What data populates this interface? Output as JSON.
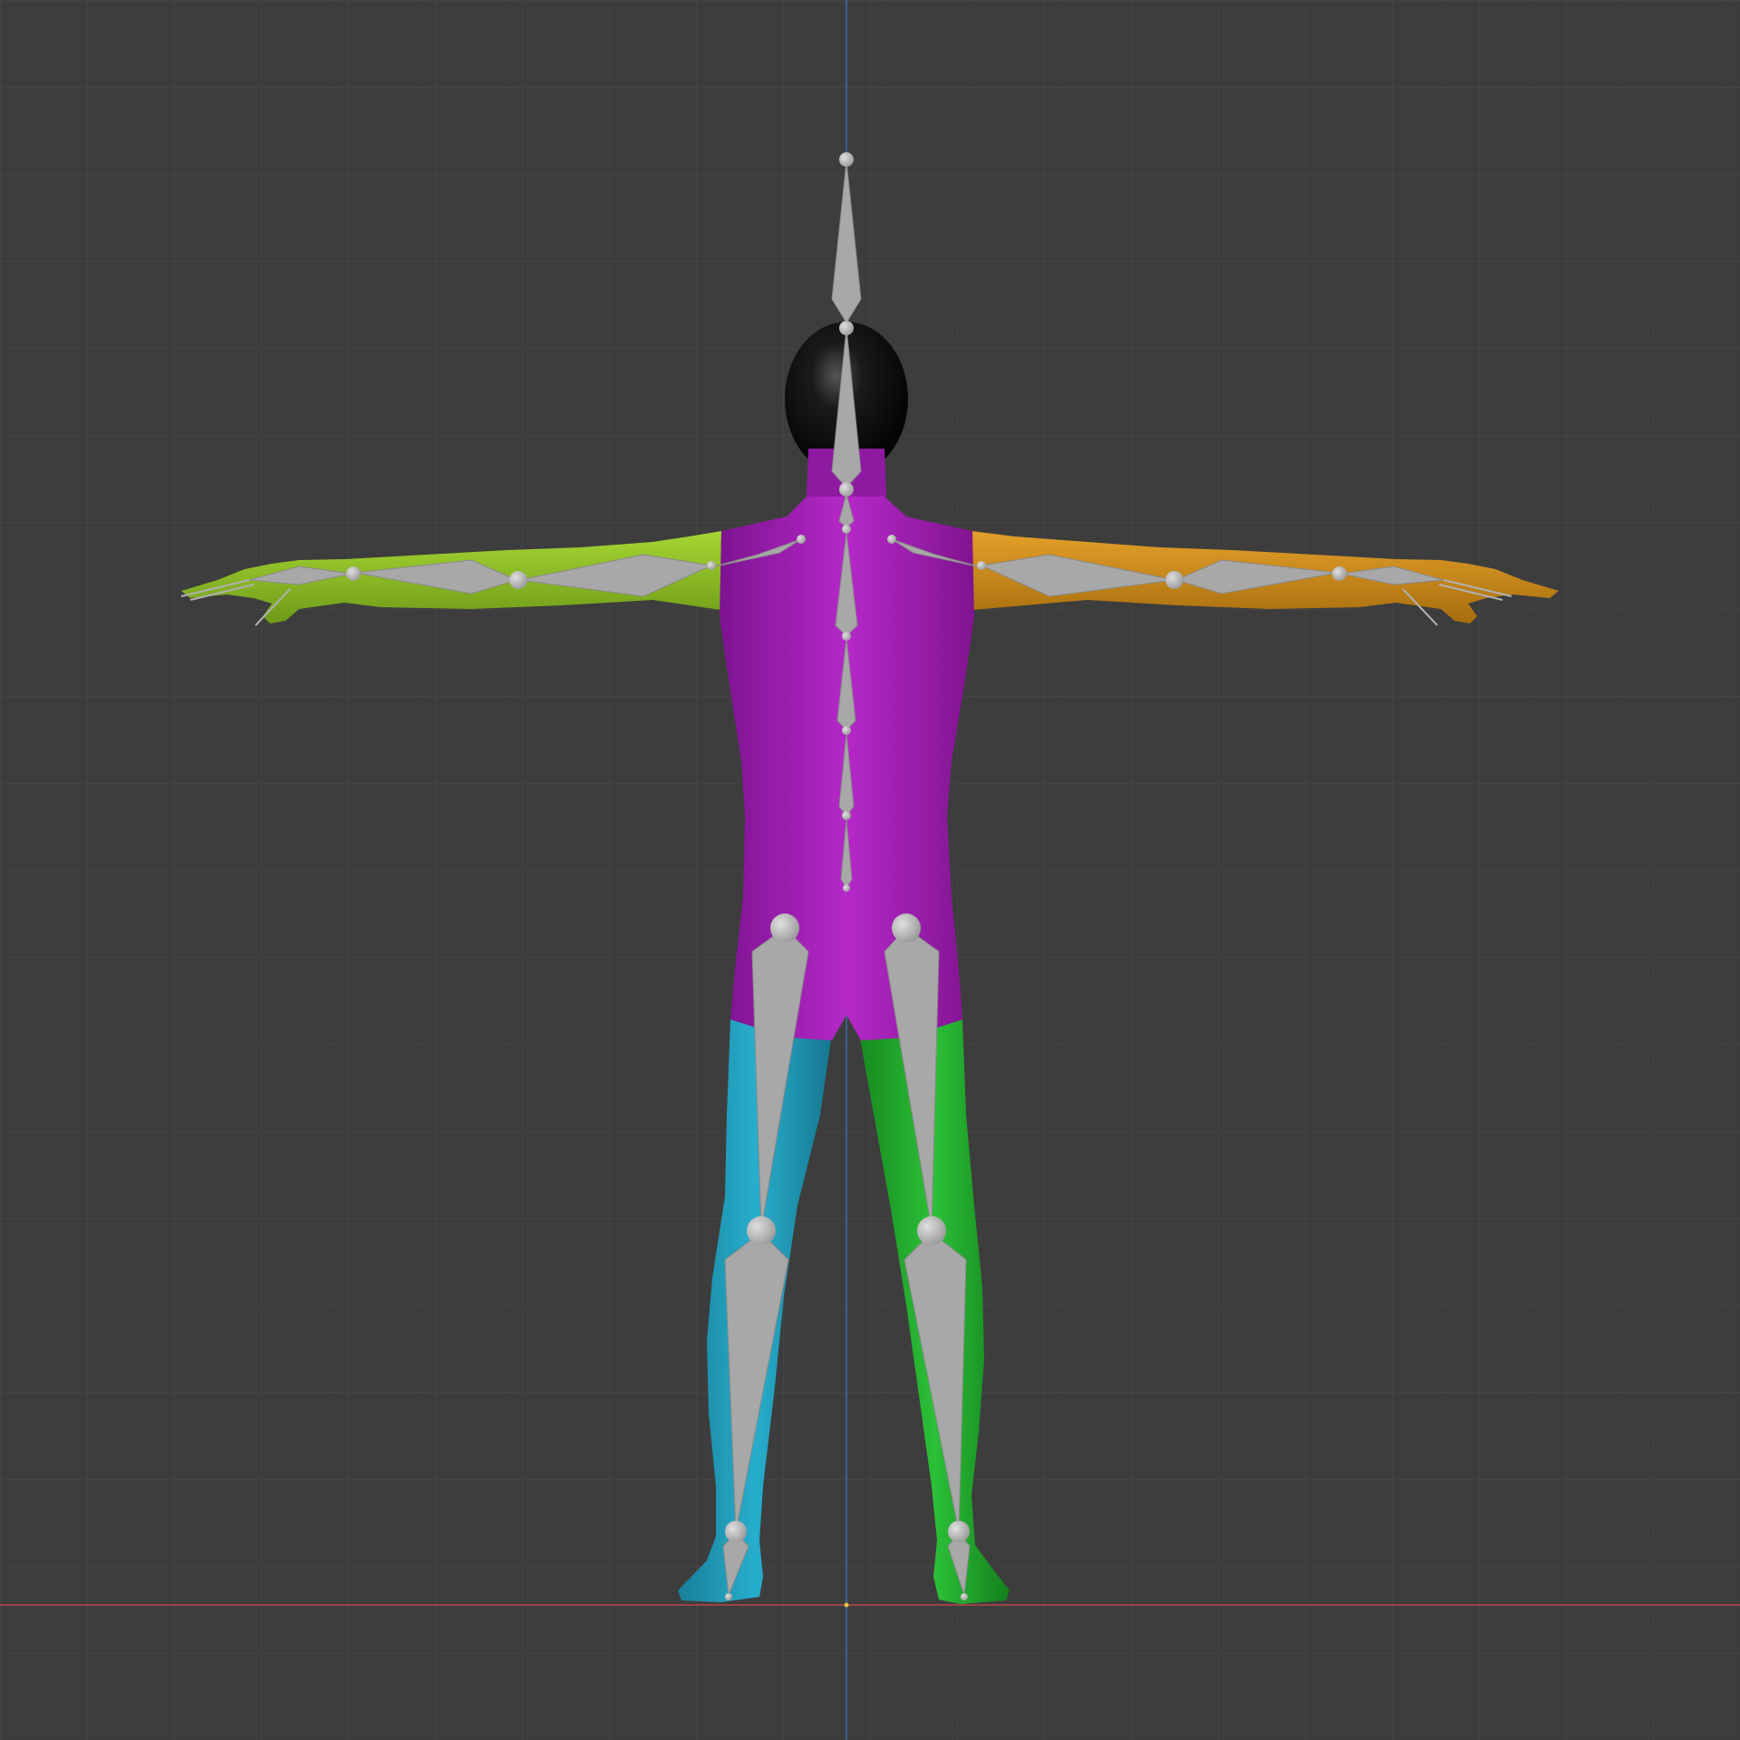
{
  "viewport": {
    "view": "front-orthographic",
    "grid": true,
    "background_color": "#3d3d3d",
    "grid_color": "#464646",
    "axis_x_color": "#b8474b",
    "axis_z_color": "#3e6aa6"
  },
  "model": {
    "pose": "T-pose",
    "parts": [
      {
        "name": "head",
        "color": "#111111"
      },
      {
        "name": "torso",
        "color": "#a51bb8"
      },
      {
        "name": "right-arm",
        "color": "#8bbe23"
      },
      {
        "name": "left-arm",
        "color": "#d08c16"
      },
      {
        "name": "right-leg",
        "color": "#1f9fbe"
      },
      {
        "name": "left-leg",
        "color": "#21ae2c"
      }
    ]
  },
  "armature": {
    "bone_color": "#a8a8a8",
    "joint_color": "#c4c4c4"
  }
}
